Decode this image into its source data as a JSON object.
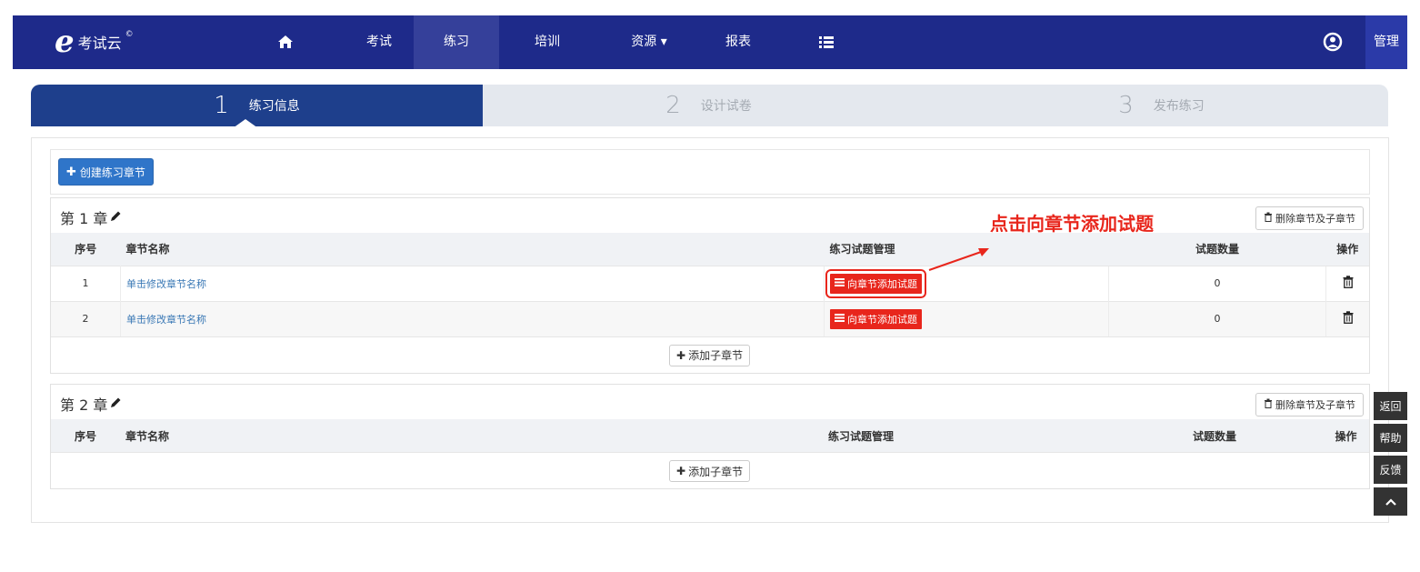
{
  "app": {
    "logo_text": "考试云",
    "logo_mark": "e",
    "logo_sup": "©"
  },
  "nav": {
    "items": [
      {
        "label": "",
        "icon": "home-icon"
      },
      {
        "label": "考试"
      },
      {
        "label": "练习",
        "active": true
      },
      {
        "label": "培训"
      },
      {
        "label": "资源 ▾"
      },
      {
        "label": "报表"
      },
      {
        "label": "",
        "icon": "list-icon"
      }
    ],
    "user_icon": "user-icon",
    "admin_label": "管理"
  },
  "steps": [
    {
      "num": "1",
      "label": "练习信息",
      "active": true
    },
    {
      "num": "2",
      "label": "设计试卷",
      "active": false
    },
    {
      "num": "3",
      "label": "发布练习",
      "active": false
    }
  ],
  "toolbar": {
    "create_chapter": "创建练习章节"
  },
  "table_headers": {
    "no": "序号",
    "name": "章节名称",
    "mgmt": "练习试题管理",
    "count": "试题数量",
    "op": "操作"
  },
  "chapters": [
    {
      "title": "第 1 章",
      "delete_label": "删除章节及子章节",
      "rows": [
        {
          "no": "1",
          "name": "单击修改章节名称",
          "action": "向章节添加试题",
          "count": "0"
        },
        {
          "no": "2",
          "name": "单击修改章节名称",
          "action": "向章节添加试题",
          "count": "0"
        }
      ],
      "add_sub": "添加子章节"
    },
    {
      "title": "第 2 章",
      "delete_label": "删除章节及子章节",
      "rows": [],
      "add_sub": "添加子章节"
    }
  ],
  "annotation": "点击向章节添加试题",
  "side_buttons": [
    "返回",
    "帮助",
    "反馈",
    "^"
  ],
  "colors": {
    "nav_bg": "#1e2a8a",
    "step_active": "#1e3f8c",
    "primary": "#2f75c9",
    "danger": "#e8261c"
  }
}
